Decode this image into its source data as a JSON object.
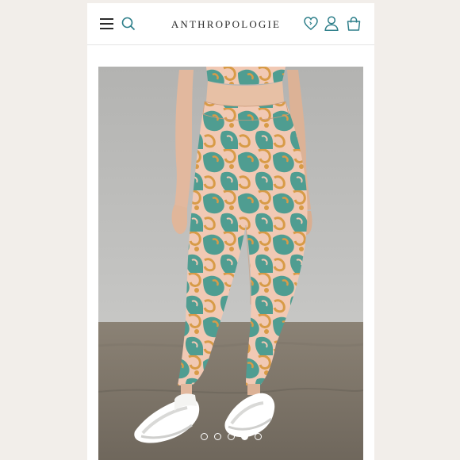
{
  "header": {
    "brand": "ANTHROPOLOGIE",
    "icons": {
      "menu": "menu-icon",
      "search": "search-icon",
      "wishlist": "heart-icon",
      "account": "user-icon",
      "bag": "shopping-bag-icon"
    }
  },
  "gallery": {
    "slides": [
      {
        "active": false
      },
      {
        "active": false
      },
      {
        "active": false
      },
      {
        "active": true
      },
      {
        "active": false
      }
    ]
  },
  "colors": {
    "brand_accent": "#2e7f8a",
    "text": "#2b2b2b",
    "print_teal": "#4f9d91",
    "print_peach": "#f1c9b4",
    "print_mustard": "#d89b47"
  }
}
